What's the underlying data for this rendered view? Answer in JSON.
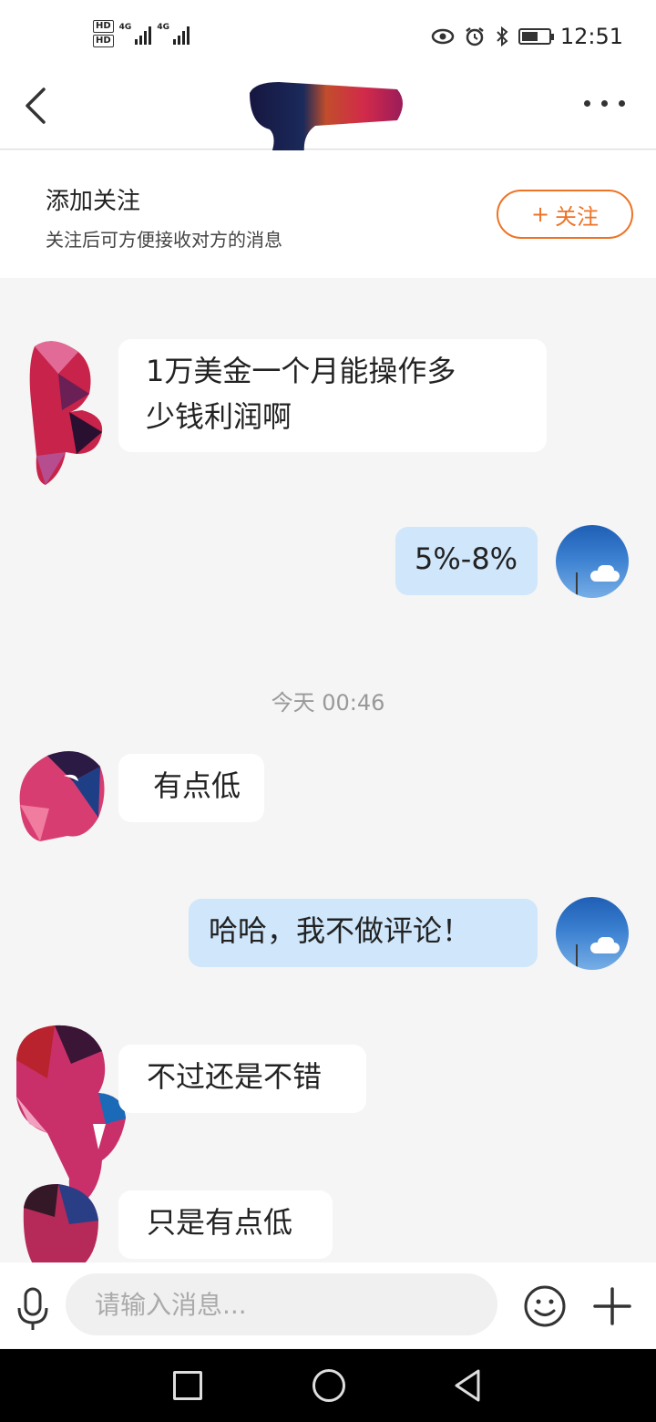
{
  "status_bar": {
    "hd1": "HD",
    "hd2": "HD",
    "net1": "4G",
    "net2": "4G",
    "time": "12:51",
    "icons": [
      "eye-icon",
      "alarm-icon",
      "bluetooth-icon",
      "battery-icon"
    ]
  },
  "header": {
    "back_icon": "chevron-left-icon",
    "more_icon": "more-dots-icon"
  },
  "follow": {
    "title": "添加关注",
    "subtitle": "关注后可方便接收对方的消息",
    "button_plus": "+",
    "button_label": "关注",
    "accent_color": "#ee7326"
  },
  "messages": [
    {
      "side": "in",
      "text": "1万美金一个月能操作多少钱利润啊"
    },
    {
      "side": "out",
      "text": "5%-8%"
    },
    {
      "side": "in",
      "text": "有点低"
    },
    {
      "side": "out",
      "text": "哈哈，我不做评论！"
    },
    {
      "side": "in",
      "text": "不过还是不错"
    },
    {
      "side": "in",
      "text": "只是有点低"
    }
  ],
  "message_lines": {
    "m0_line1": "1万美金一个月能操作多",
    "m0_line2": "少钱利润啊"
  },
  "timestamp": "今天 00:46",
  "input": {
    "placeholder": "请输入消息..."
  },
  "colors": {
    "incoming_bubble": "#ffffff",
    "outgoing_bubble": "#cfe6fb",
    "chat_background": "#f5f5f5"
  }
}
